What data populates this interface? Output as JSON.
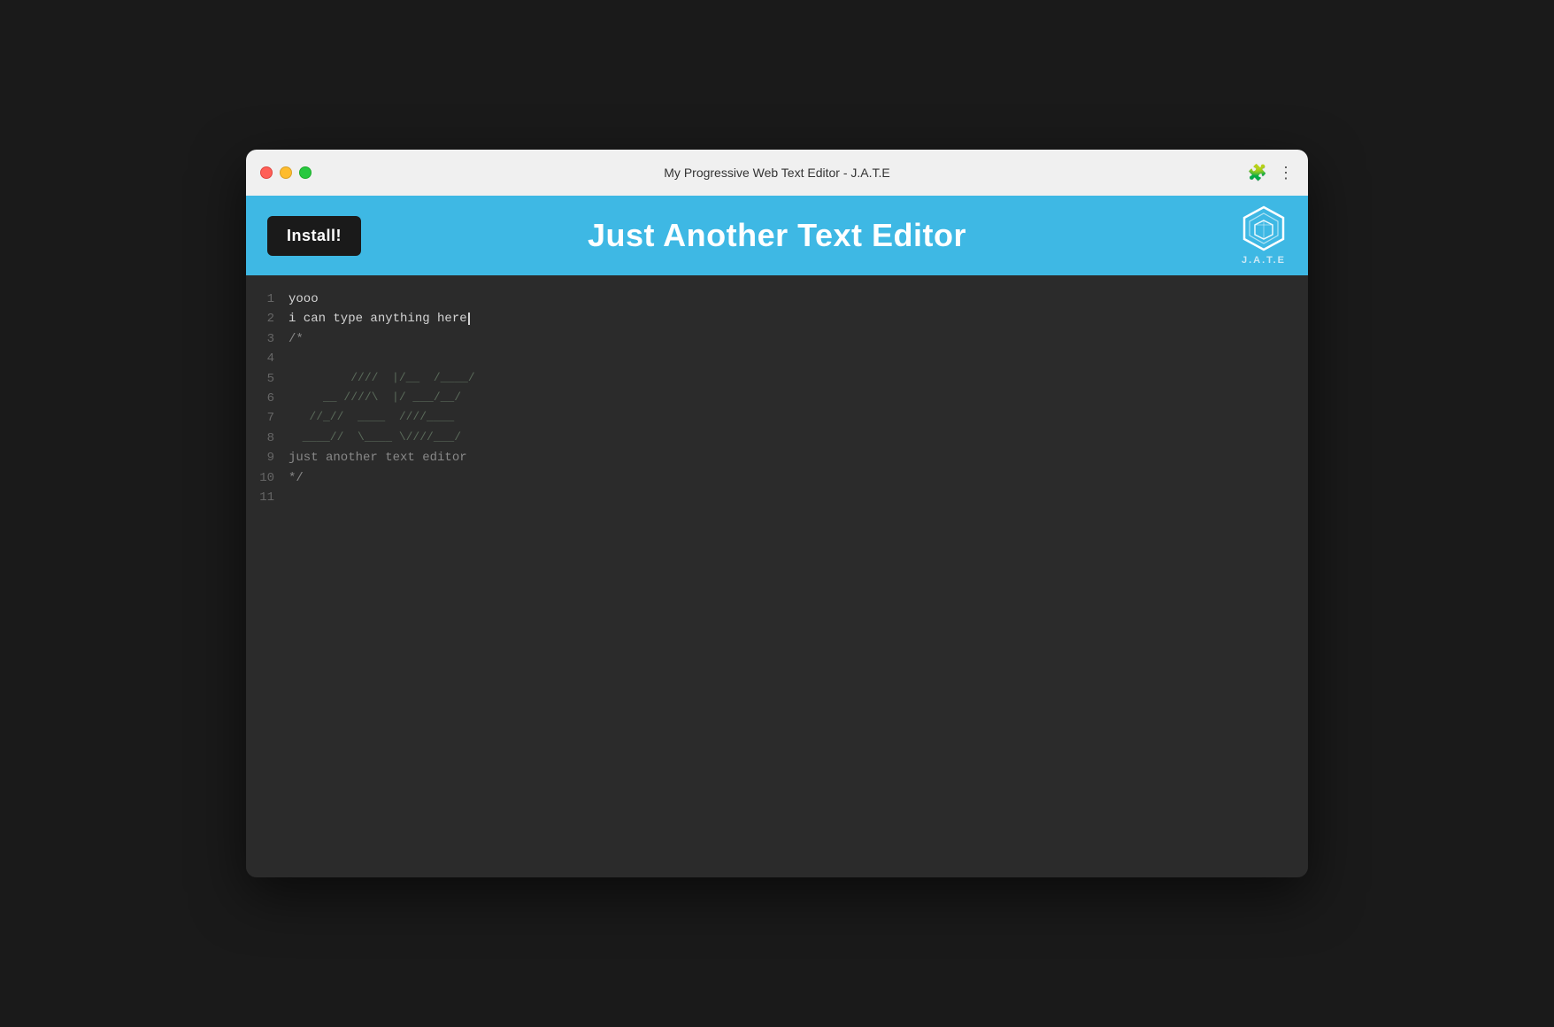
{
  "titleBar": {
    "title": "My Progressive Web Text Editor - J.A.T.E",
    "trafficLights": [
      "close",
      "minimize",
      "maximize"
    ],
    "icons": {
      "extensions": "🧩",
      "menu": "⋮"
    }
  },
  "header": {
    "installButton": "Install!",
    "appTitle": "Just Another Text Editor",
    "logoLabel": "J.A.T.E"
  },
  "editor": {
    "lines": [
      {
        "num": 1,
        "content": "yooo",
        "type": "normal"
      },
      {
        "num": 2,
        "content": "i can type anything here",
        "type": "cursor"
      },
      {
        "num": 3,
        "content": "/*",
        "type": "comment"
      },
      {
        "num": 4,
        "content": "",
        "type": "comment"
      },
      {
        "num": 5,
        "content": "        ////  |/___/____/",
        "type": "ascii"
      },
      {
        "num": 6,
        "content": "       ////\\  |/___/__/",
        "type": "ascii"
      },
      {
        "num": 7,
        "content": "      //_// ____ ////___",
        "type": "ascii"
      },
      {
        "num": 8,
        "content": "     ___//  \\____////___/",
        "type": "ascii"
      },
      {
        "num": 9,
        "content": "just another text editor",
        "type": "comment"
      },
      {
        "num": 10,
        "content": "*/",
        "type": "comment"
      },
      {
        "num": 11,
        "content": "",
        "type": "normal"
      }
    ]
  }
}
